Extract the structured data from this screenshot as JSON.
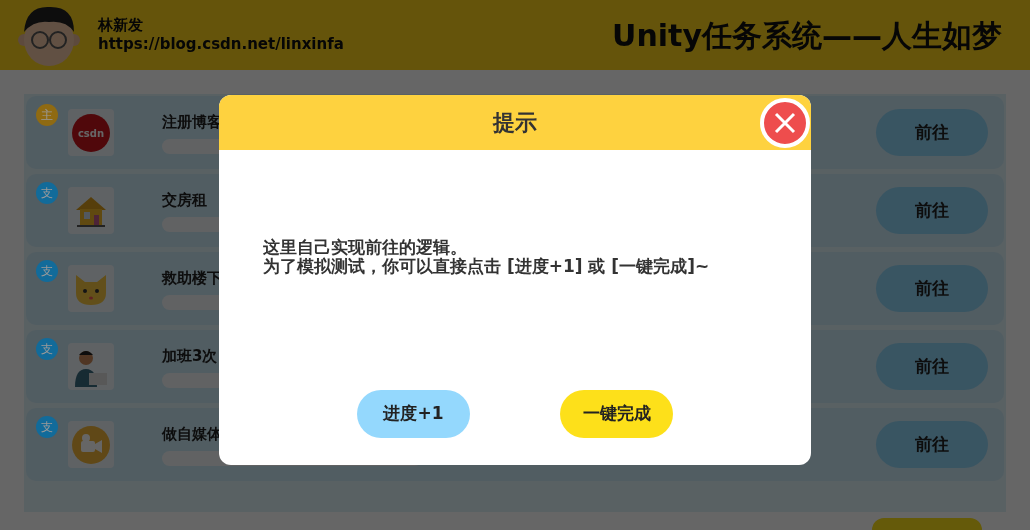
{
  "header": {
    "author": "林新发",
    "url": "https://blog.csdn.net/linxinfa",
    "title": "Unity任务系统——人生如梦"
  },
  "tasks": [
    {
      "badge": "主",
      "color": "#8f6a12",
      "icon_text": "csdn",
      "title": "注册博客",
      "button": "前往"
    },
    {
      "badge": "支",
      "color": "#126b9a",
      "title": "交房租",
      "button": "前往"
    },
    {
      "badge": "支",
      "color": "#126b9a",
      "title": "救助楼下",
      "button": "前往"
    },
    {
      "badge": "支",
      "color": "#126b9a",
      "title": "加班3次",
      "button": "前往"
    },
    {
      "badge": "支",
      "color": "#126b9a",
      "title": "做自媒体",
      "button": "前往"
    }
  ],
  "dialog": {
    "title": "提示",
    "message": [
      "这里自己实现前往的逻辑。",
      "为了模拟测试，你可以直接点击 [进度+1] 或 [一键完成]~"
    ],
    "buttons": [
      {
        "label": "进度+1",
        "kind": "progress"
      },
      {
        "label": "一键完成",
        "kind": "complete"
      }
    ]
  }
}
